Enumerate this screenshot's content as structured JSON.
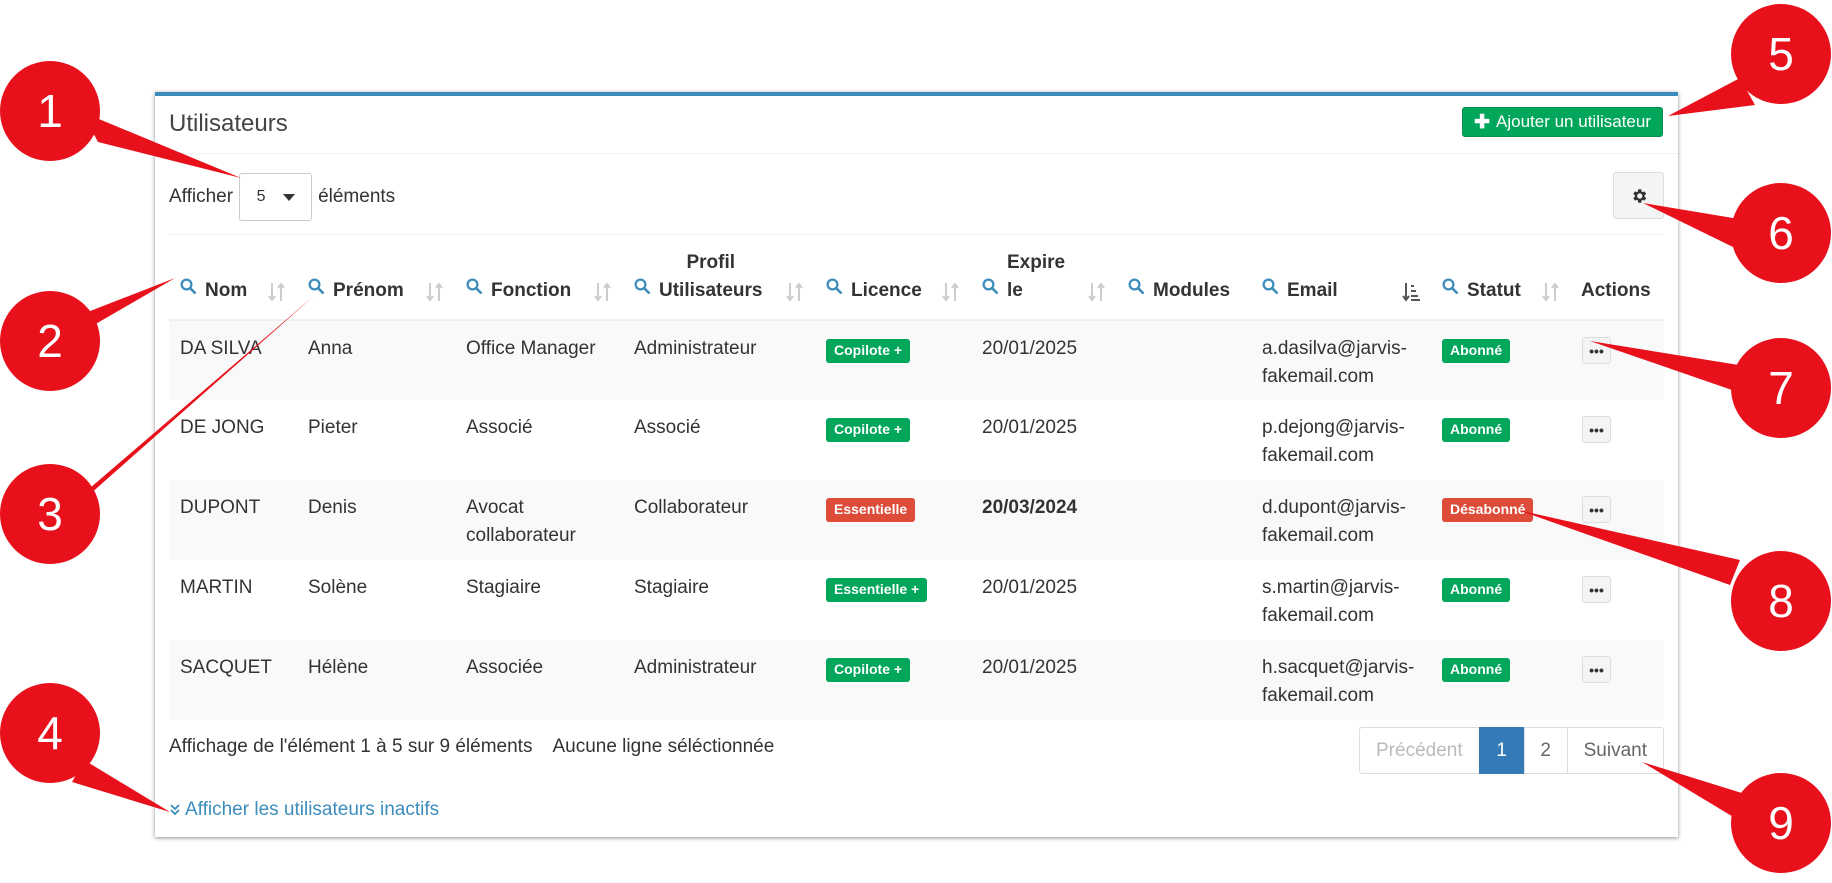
{
  "panel": {
    "title": "Utilisateurs",
    "add_button_label": "Ajouter un utilisateur"
  },
  "length": {
    "prefix": "Afficher",
    "value": "5",
    "suffix": "éléments"
  },
  "columns": [
    {
      "label": "Nom",
      "search": true,
      "sort": "both"
    },
    {
      "label": "Prénom",
      "search": true,
      "sort": "both"
    },
    {
      "label": "Fonction",
      "search": true,
      "sort": "both"
    },
    {
      "label_line1": "Profil",
      "label": "Utilisateurs",
      "search": true,
      "sort": "both"
    },
    {
      "label": "Licence",
      "search": true,
      "sort": "both"
    },
    {
      "label_line1": "Expire",
      "label": "le",
      "search": true,
      "sort": "both"
    },
    {
      "label": "Modules",
      "search": true,
      "sort": "none"
    },
    {
      "label": "Email",
      "search": true,
      "sort": "desc"
    },
    {
      "label": "Statut",
      "search": true,
      "sort": "both"
    },
    {
      "label": "Actions",
      "search": false,
      "sort": "none"
    }
  ],
  "rows": [
    {
      "nom": "DA SILVA",
      "prenom": "Anna",
      "fonction_1": "Office Manager",
      "fonction_2": "",
      "profil": "Administrateur",
      "licence": "Copilote +",
      "licence_color": "#00a65a",
      "expire": "20/01/2025",
      "expire_bold": false,
      "modules": "",
      "email_1": "a.dasilva@jarvis-",
      "email_2": "fakemail.com",
      "statut": "Abonné",
      "statut_color": "#00a65a"
    },
    {
      "nom": "DE JONG",
      "prenom": "Pieter",
      "fonction_1": "Associé",
      "fonction_2": "",
      "profil": "Associé",
      "licence": "Copilote +",
      "licence_color": "#00a65a",
      "expire": "20/01/2025",
      "expire_bold": false,
      "modules": "",
      "email_1": "p.dejong@jarvis-",
      "email_2": "fakemail.com",
      "statut": "Abonné",
      "statut_color": "#00a65a"
    },
    {
      "nom": "DUPONT",
      "prenom": "Denis",
      "fonction_1": "Avocat",
      "fonction_2": "collaborateur",
      "profil": "Collaborateur",
      "licence": "Essentielle",
      "licence_color": "#dd4b39",
      "expire": "20/03/2024",
      "expire_bold": true,
      "modules": "",
      "email_1": "d.dupont@jarvis-",
      "email_2": "fakemail.com",
      "statut": "Désabonné",
      "statut_color": "#dd4b39"
    },
    {
      "nom": "MARTIN",
      "prenom": "Solène",
      "fonction_1": "Stagiaire",
      "fonction_2": "",
      "profil": "Stagiaire",
      "licence": "Essentielle +",
      "licence_color": "#00a65a",
      "expire": "20/01/2025",
      "expire_bold": false,
      "modules": "",
      "email_1": "s.martin@jarvis-",
      "email_2": "fakemail.com",
      "statut": "Abonné",
      "statut_color": "#00a65a"
    },
    {
      "nom": "SACQUET",
      "prenom": "Hélène",
      "fonction_1": "Associée",
      "fonction_2": "",
      "profil": "Administrateur",
      "licence": "Copilote +",
      "licence_color": "#00a65a",
      "expire": "20/01/2025",
      "expire_bold": false,
      "modules": "",
      "email_1": "h.sacquet@jarvis-",
      "email_2": "fakemail.com",
      "statut": "Abonné",
      "statut_color": "#00a65a"
    }
  ],
  "actions_label": "•••",
  "info": {
    "range": "Affichage de l'élément 1 à 5 sur 9 éléments",
    "selection": "Aucune ligne séléctionnée"
  },
  "pagination": {
    "previous": "Précédent",
    "pages": [
      "1",
      "2"
    ],
    "active_page": "1",
    "next": "Suivant"
  },
  "inactive_link": "Afficher les utilisateurs inactifs",
  "callouts": [
    "1",
    "2",
    "3",
    "4",
    "5",
    "6",
    "7",
    "8",
    "9"
  ],
  "colors": {
    "primary": "#3c8dbc",
    "success": "#00a65a",
    "danger": "#dd4b39",
    "active_page": "#337ab7",
    "callout": "#e8111b"
  },
  "icons": {
    "search": "search-icon",
    "sort": "sort-icon",
    "gear": "gear-icon",
    "plus": "plus-icon",
    "chevron": "double-chevron-down-icon"
  }
}
